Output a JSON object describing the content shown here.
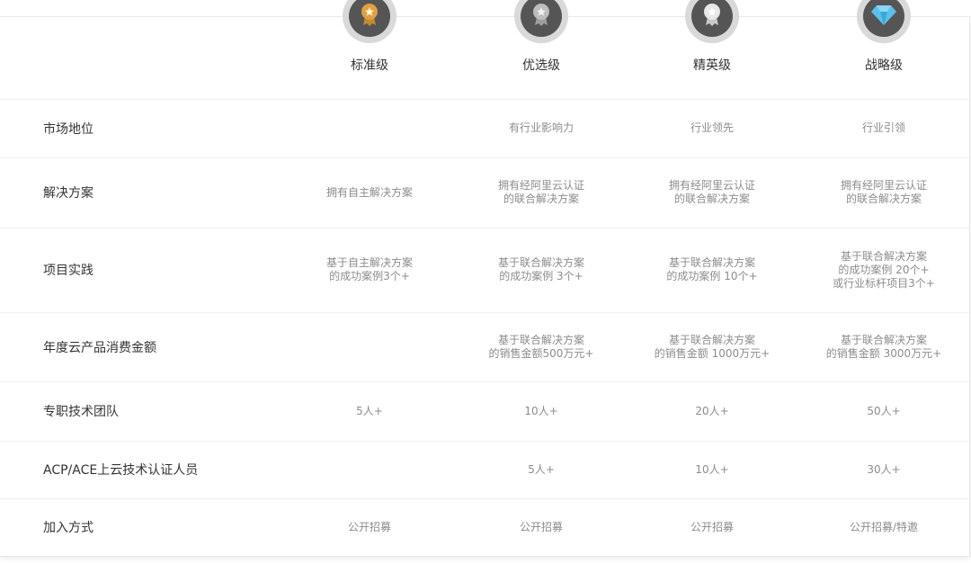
{
  "tiers": [
    {
      "name": "标准级",
      "icon": "gold-medal-icon"
    },
    {
      "name": "优选级",
      "icon": "silver-medal-icon"
    },
    {
      "name": "精英级",
      "icon": "platinum-medal-icon"
    },
    {
      "name": "战略级",
      "icon": "diamond-icon"
    }
  ],
  "rows": [
    {
      "label": "市场地位",
      "cells": [
        "",
        "有行业影响力",
        "行业领先",
        "行业引领"
      ]
    },
    {
      "label": "解决方案",
      "cells": [
        "拥有自主解决方案",
        "拥有经阿里云认证\n的联合解决方案",
        "拥有经阿里云认证\n的联合解决方案",
        "拥有经阿里云认证\n的联合解决方案"
      ]
    },
    {
      "label": "项目实践",
      "cells": [
        "基于自主解决方案\n的成功案例3个+",
        "基于联合解决方案\n的成功案例 3个+",
        "基于联合解决方案\n的成功案例 10个+",
        "基于联合解决方案\n的成功案例 20个+\n或行业标杆项目3个+"
      ]
    },
    {
      "label": "年度云产品消费金额",
      "cells": [
        "",
        "基于联合解决方案\n的销售金额500万元+",
        "基于联合解决方案\n的销售金额 1000万元+",
        "基于联合解决方案\n的销售金额 3000万元+"
      ]
    },
    {
      "label": "专职技术团队",
      "cells": [
        "5人+",
        "10人+",
        "20人+",
        "50人+"
      ]
    },
    {
      "label": "ACP/ACE上云技术认证人员",
      "cells": [
        "",
        "5人+",
        "10人+",
        "30人+"
      ]
    },
    {
      "label": "加入方式",
      "cells": [
        "公开招募",
        "公开招募",
        "公开招募",
        "公开招募/特邀"
      ]
    }
  ],
  "colors": {
    "gold": "#e0a040",
    "silver": "#bdbdbd",
    "diamond": "#5bc0eb",
    "badge_ring": "#d9d9d9",
    "badge_inner": "#555555"
  }
}
